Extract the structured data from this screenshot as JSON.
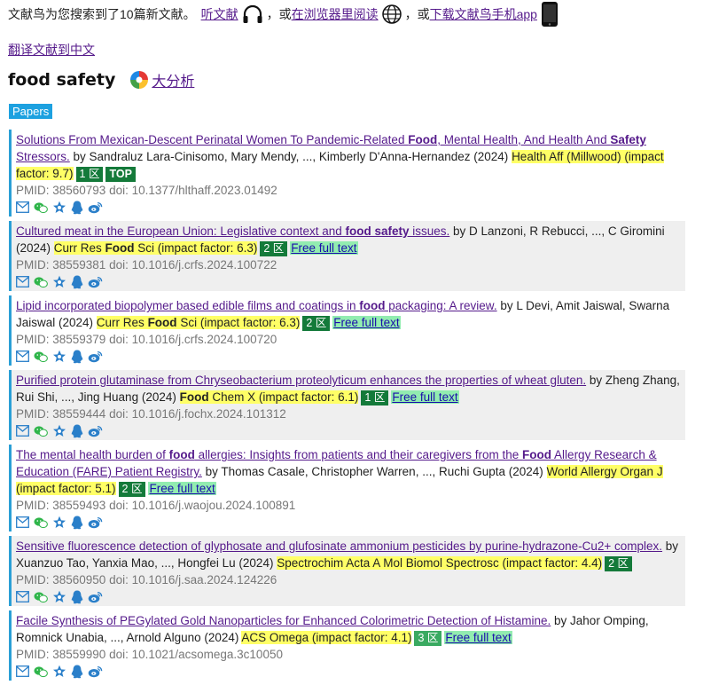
{
  "header": {
    "intro": "文献鸟为您搜索到了10篇新文献。",
    "listen_link": "听文献",
    "sep1": "，或",
    "browser_link": "在浏览器里阅读",
    "sep2": "，或",
    "app_link": "下载文献鸟手机app"
  },
  "translate_link": "翻译文献到中文",
  "search": {
    "query": "food safety",
    "analysis_link": "大分析"
  },
  "section_tag": "Papers",
  "colors": {
    "accent": "#2a9fd6",
    "highlight": "#ffff66",
    "zone_badge": "#147a3a",
    "free_full_text": "#92ecb0"
  },
  "icon_names": [
    "mail-icon",
    "wechat-icon",
    "star-icon",
    "qq-icon",
    "weibo-icon"
  ],
  "papers": [
    {
      "title_parts": [
        {
          "text": "Solutions From Mexican-Descent Perinatal Women To Pandemic-Related ",
          "bold": false
        },
        {
          "text": "Food",
          "bold": true
        },
        {
          "text": ", Mental Health, And Health And ",
          "bold": false
        },
        {
          "text": "Safety",
          "bold": true
        },
        {
          "text": " Stressors.",
          "bold": false
        }
      ],
      "authors": " by Sandraluz Lara-Cinisomo, Mary Mendy, ..., Kimberly D'Anna-Hernandez (2024) ",
      "journal_parts": [
        {
          "text": "Health Aff (Millwood) (impact factor: 9.7)",
          "bold": false
        }
      ],
      "zone": "1 区",
      "zone_light": false,
      "top": "TOP",
      "free_full_text": null,
      "ids": "PMID: 38560793 doi: 10.1377/hlthaff.2023.01492"
    },
    {
      "title_parts": [
        {
          "text": "Cultured meat in the European Union: Legislative context and ",
          "bold": false
        },
        {
          "text": "food safety",
          "bold": true
        },
        {
          "text": " issues.",
          "bold": false
        }
      ],
      "authors": " by D Lanzoni, R Rebucci, ..., C Giromini (2024) ",
      "journal_parts": [
        {
          "text": "Curr Res ",
          "bold": false
        },
        {
          "text": "Food",
          "bold": true
        },
        {
          "text": " Sci (impact factor: 6.3)",
          "bold": false
        }
      ],
      "zone": "2 区",
      "zone_light": false,
      "top": null,
      "free_full_text": "Free full text",
      "ids": "PMID: 38559381 doi: 10.1016/j.crfs.2024.100722"
    },
    {
      "title_parts": [
        {
          "text": "Lipid incorporated biopolymer based edible films and coatings in ",
          "bold": false
        },
        {
          "text": "food",
          "bold": true
        },
        {
          "text": " packaging: A review.",
          "bold": false
        }
      ],
      "authors": " by L Devi, Amit Jaiswal, Swarna Jaiswal (2024) ",
      "journal_parts": [
        {
          "text": "Curr Res ",
          "bold": false
        },
        {
          "text": "Food",
          "bold": true
        },
        {
          "text": " Sci (impact factor: 6.3)",
          "bold": false
        }
      ],
      "zone": "2 区",
      "zone_light": false,
      "top": null,
      "free_full_text": "Free full text",
      "ids": "PMID: 38559379 doi: 10.1016/j.crfs.2024.100720"
    },
    {
      "title_parts": [
        {
          "text": "Purified protein glutaminase from Chryseobacterium proteolyticum enhances the properties of wheat gluten.",
          "bold": false
        }
      ],
      "authors": " by Zheng Zhang, Rui Shi, ..., Jing Huang (2024) ",
      "journal_parts": [
        {
          "text": "Food",
          "bold": true
        },
        {
          "text": " Chem X (impact factor: 6.1)",
          "bold": false
        }
      ],
      "zone": "1 区",
      "zone_light": false,
      "top": null,
      "free_full_text": "Free full text",
      "ids": "PMID: 38559444 doi: 10.1016/j.fochx.2024.101312"
    },
    {
      "title_parts": [
        {
          "text": "The mental health burden of ",
          "bold": false
        },
        {
          "text": "food",
          "bold": true
        },
        {
          "text": " allergies: Insights from patients and their caregivers from the ",
          "bold": false
        },
        {
          "text": "Food",
          "bold": true
        },
        {
          "text": " Allergy Research & Education (FARE) Patient Registry.",
          "bold": false
        }
      ],
      "authors": " by Thomas Casale, Christopher Warren, ..., Ruchi Gupta (2024) ",
      "journal_parts": [
        {
          "text": "World Allergy Organ J (impact factor: 5.1)",
          "bold": false
        }
      ],
      "zone": "2 区",
      "zone_light": false,
      "top": null,
      "free_full_text": "Free full text",
      "ids": "PMID: 38559493 doi: 10.1016/j.waojou.2024.100891"
    },
    {
      "title_parts": [
        {
          "text": "Sensitive fluorescence detection of glyphosate and glufosinate ammonium pesticides by purine-hydrazone-Cu2+ complex.",
          "bold": false
        }
      ],
      "authors": " by Xuanzuo Tao, Yanxia Mao, ..., Hongfei Lu (2024) ",
      "journal_parts": [
        {
          "text": "Spectrochim Acta A Mol Biomol Spectrosc (impact factor: 4.4)",
          "bold": false
        }
      ],
      "zone": "2 区",
      "zone_light": false,
      "top": null,
      "free_full_text": null,
      "ids": "PMID: 38560950 doi: 10.1016/j.saa.2024.124226"
    },
    {
      "title_parts": [
        {
          "text": "Facile Synthesis of PEGylated Gold Nanoparticles for Enhanced Colorimetric Detection of Histamine.",
          "bold": false
        }
      ],
      "authors": " by Jahor Omping, Romnick Unabia, ..., Arnold Alguno (2024) ",
      "journal_parts": [
        {
          "text": "ACS Omega (impact factor: 4.1)",
          "bold": false
        }
      ],
      "zone": "3 区",
      "zone_light": true,
      "top": null,
      "free_full_text": "Free full text",
      "ids": "PMID: 38559990 doi: 10.1021/acsomega.3c10050"
    }
  ]
}
